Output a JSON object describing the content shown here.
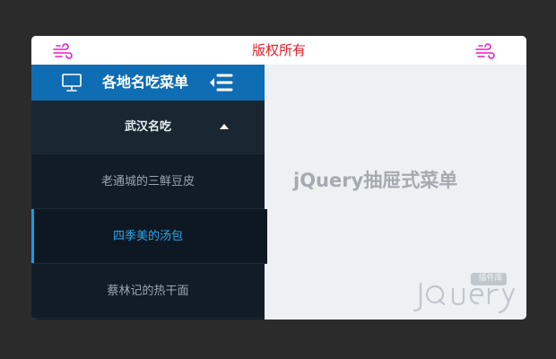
{
  "topbar": {
    "title": "版权所有",
    "left_icon": "wind-icon",
    "right_icon": "wind-icon",
    "accent_color": "#e0202a",
    "icon_color": "#e020c8"
  },
  "sidebar": {
    "header": {
      "icon": "monitor-icon",
      "title": "各地名吃菜单",
      "toggle_icon": "menu-collapse-icon",
      "background": "#0f6db3"
    },
    "group": {
      "label": "武汉名吃",
      "caret_icon": "caret-up-icon",
      "expanded": true
    },
    "items": [
      {
        "label": "老通城的三鲜豆皮",
        "active": false
      },
      {
        "label": "四季美的汤包",
        "active": true
      },
      {
        "label": "蔡林记的热干面",
        "active": false
      }
    ],
    "active_color": "#1b9ce0"
  },
  "main": {
    "heading": "jQuery抽屉式菜单",
    "watermark": {
      "text": "jQuery",
      "badge": "插件库"
    }
  }
}
